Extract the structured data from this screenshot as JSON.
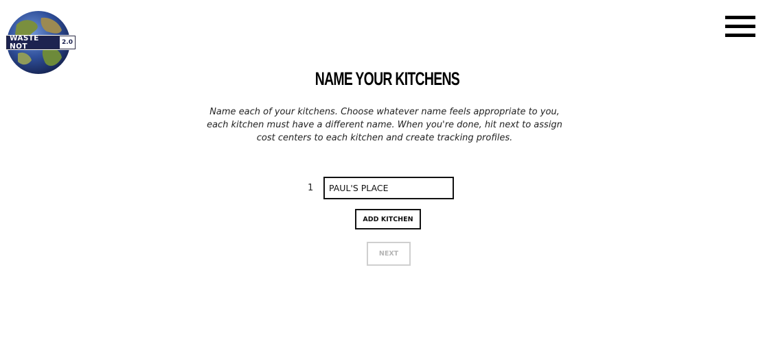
{
  "logo": {
    "name": "WASTE NOT",
    "version": "2.0"
  },
  "header": {
    "menu_icon": "hamburger-menu-icon"
  },
  "main": {
    "title": "NAME YOUR KITCHENS",
    "description": "Name each of your kitchens. Choose whatever name feels appropriate to you, each kitchen must have a different name. When you're done, hit next to assign cost centers to each kitchen and create tracking profiles.",
    "kitchens": [
      {
        "number": "1",
        "value": "PAUL'S PLACE"
      }
    ],
    "add_kitchen_label": "ADD KITCHEN",
    "next_label": "NEXT"
  },
  "colors": {
    "logo_navy": "#1d2350",
    "text": "#111111",
    "disabled": "#b5b5b5"
  }
}
